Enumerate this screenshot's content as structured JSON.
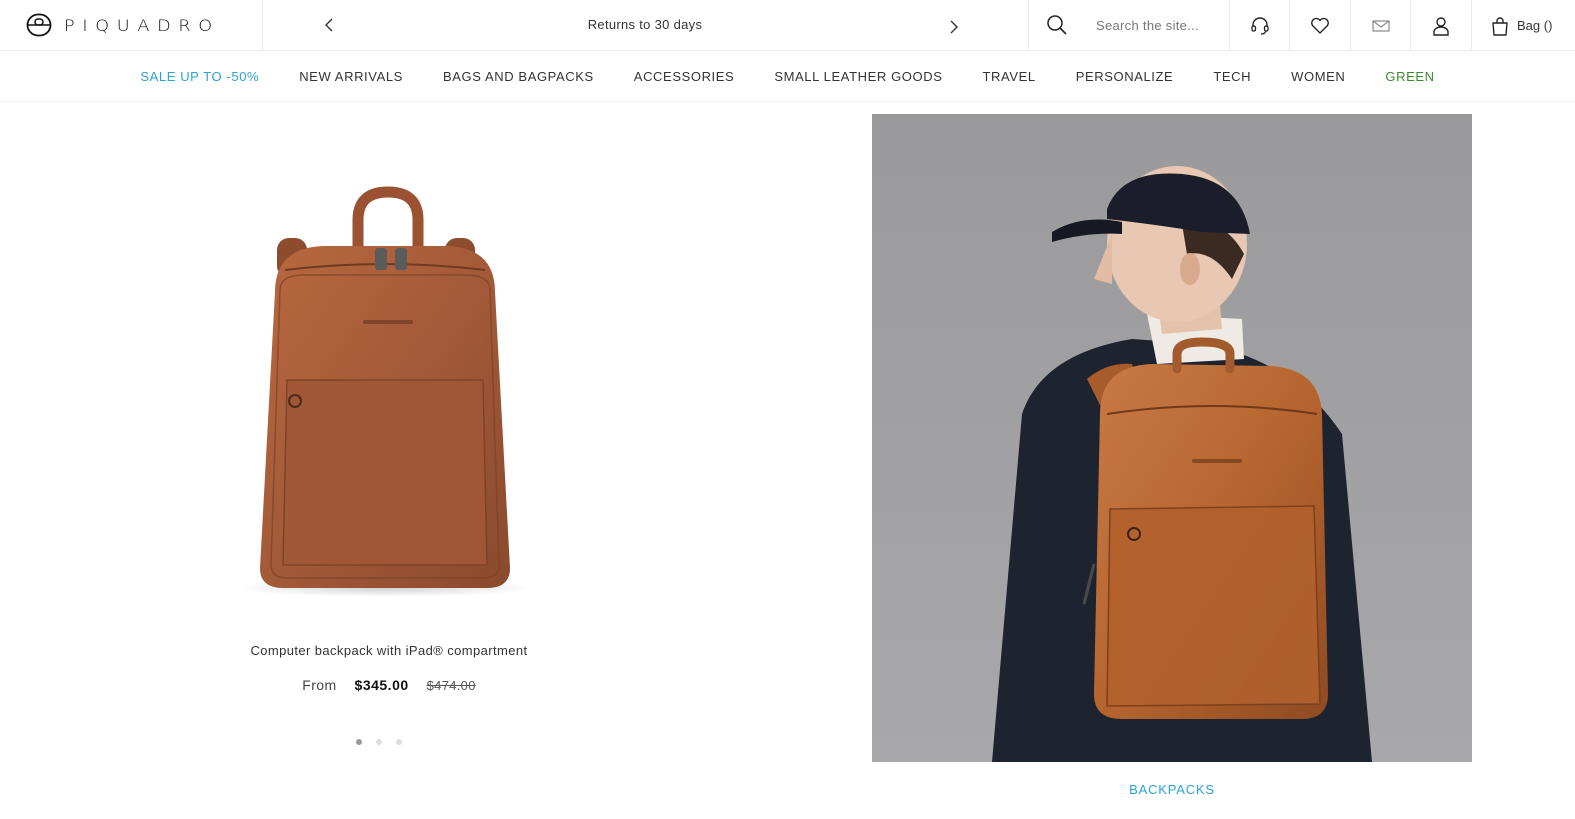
{
  "brand": {
    "name": "PIQUADRO"
  },
  "promo": {
    "text": "Returns to 30 days"
  },
  "search": {
    "placeholder": "Search the site..."
  },
  "header_icons": [
    "headset-icon",
    "heart-icon",
    "envelope-icon",
    "user-icon",
    "shopping-bag-icon"
  ],
  "bag": {
    "label": "Bag ()"
  },
  "nav": {
    "items": [
      {
        "label": "SALE UP TO -50%",
        "color": "#2aa3d6"
      },
      {
        "label": "NEW ARRIVALS",
        "color": "#333333"
      },
      {
        "label": "BAGS AND BAGPACKS",
        "color": "#333333"
      },
      {
        "label": "ACCESSORIES",
        "color": "#333333"
      },
      {
        "label": "SMALL LEATHER GOODS",
        "color": "#333333"
      },
      {
        "label": "TRAVEL",
        "color": "#333333"
      },
      {
        "label": "PERSONALIZE",
        "color": "#333333"
      },
      {
        "label": "TECH",
        "color": "#333333"
      },
      {
        "label": "WOMEN",
        "color": "#333333"
      },
      {
        "label": "GREEN",
        "color": "#3c8a2e"
      }
    ]
  },
  "product": {
    "name": "Computer backpack with iPad® compartment",
    "price_prefix": "From",
    "price": "$345.00",
    "original_price": "$474.00",
    "color_hex": "#a35a38",
    "carousel": {
      "count": 3,
      "active": 0
    }
  },
  "editorial": {
    "label": "BACKPACKS",
    "label_color": "#2aa3d6"
  }
}
